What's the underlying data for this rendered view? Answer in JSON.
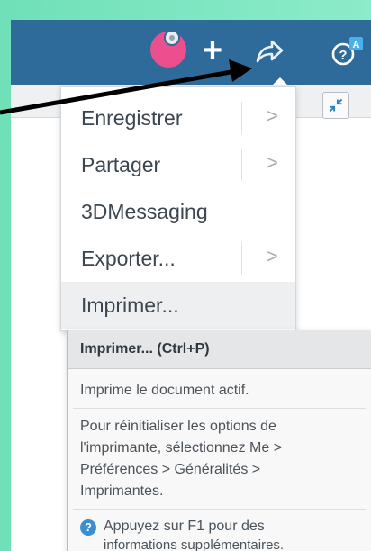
{
  "toolbar": {
    "plus_symbol": "+",
    "help_badge": "A",
    "accent_color": "#2f6b9a",
    "avatar_color": "#ec4f8d"
  },
  "share_menu": {
    "items": [
      {
        "label": "Enregistrer",
        "has_submenu": true,
        "chevron": ">"
      },
      {
        "label": "Partager",
        "has_submenu": true,
        "chevron": ">"
      },
      {
        "label": "3DMessaging",
        "has_submenu": false
      },
      {
        "label": "Exporter...",
        "has_submenu": true,
        "chevron": ">"
      },
      {
        "label": "Imprimer...",
        "has_submenu": false
      }
    ]
  },
  "tooltip": {
    "title": "Imprimer... (Ctrl+P)",
    "description": "Imprime le document actif.",
    "reset_lines": [
      "Pour réinitialiser les options de",
      "l'imprimante, sélectionnez Me >",
      "Préférences > Généralités >",
      "Imprimantes."
    ],
    "help_lines": [
      "Appuyez sur F1 pour des",
      "informations supplémentaires."
    ]
  },
  "icons": {
    "share": "share-arrow-icon",
    "help": "help-icon",
    "collapse": "collapse-icon",
    "plus": "plus-icon",
    "avatar": "user-avatar"
  }
}
